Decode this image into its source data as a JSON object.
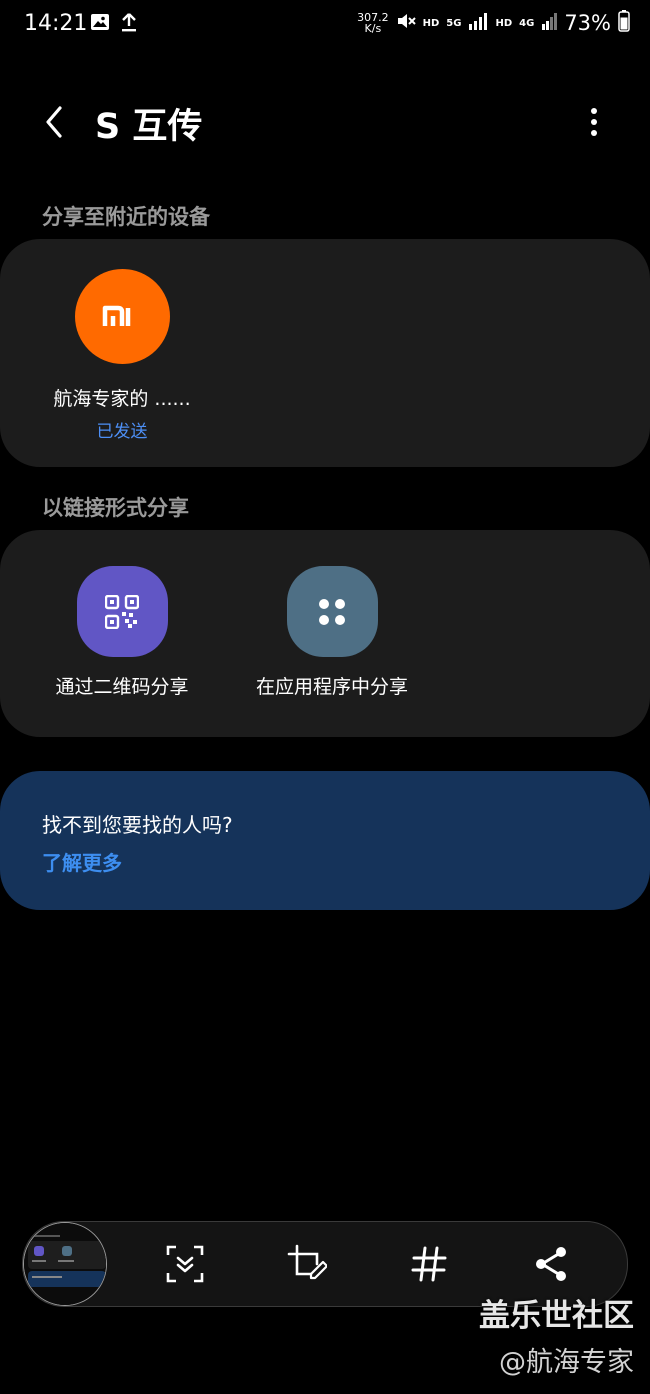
{
  "status_bar": {
    "time": "14:21",
    "net_speed_value": "307.2",
    "net_speed_unit": "K/s",
    "hd_1": "HD",
    "network_5g": "5G",
    "hd_2": "HD",
    "network_4g": "4G",
    "battery": "73%",
    "icons": [
      "gallery-icon",
      "upload-icon",
      "mute-icon",
      "signal-icon",
      "battery-icon"
    ]
  },
  "header": {
    "title": "S 互传"
  },
  "nearby": {
    "section_label": "分享至附近的设备",
    "device": {
      "logo_text": "MI",
      "name": "航海专家的 ......",
      "status": "已发送"
    }
  },
  "link_share": {
    "section_label": "以链接形式分享",
    "options": [
      {
        "label": "通过二维码分享",
        "icon": "qr-code-icon",
        "color": "#6156c5"
      },
      {
        "label": "在应用程序中分享",
        "icon": "apps-icon",
        "color": "#4e6f85"
      }
    ]
  },
  "help": {
    "title": "找不到您要找的人吗?",
    "link": "了解更多"
  },
  "screenshot_toolbar": {
    "tools": [
      "scroll-capture-icon",
      "crop-edit-icon",
      "hashtag-icon",
      "share-icon"
    ]
  },
  "watermark": {
    "line1": "盖乐世社区",
    "line2": "@航海专家"
  },
  "colors": {
    "background": "#000000",
    "card": "#1c1c1c",
    "mi_orange": "#ff6a00",
    "accent_blue": "#4d8ff5",
    "help_card": "#15335a"
  }
}
